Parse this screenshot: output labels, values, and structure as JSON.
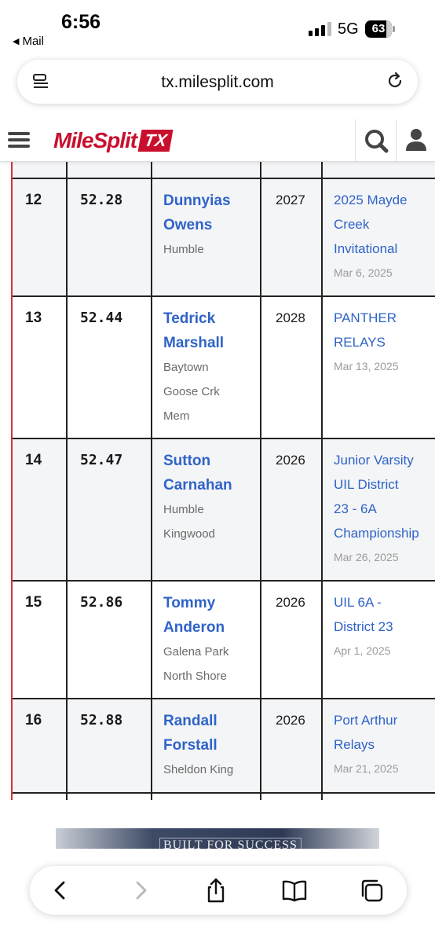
{
  "status_bar": {
    "time": "6:56",
    "back_app": "Mail",
    "network": "5G",
    "battery": "63"
  },
  "browser": {
    "url": "tx.milesplit.com"
  },
  "site": {
    "logo_text": "MileSplit",
    "logo_region": "TX",
    "brand_color": "#c8102e"
  },
  "rows": [
    {
      "rank": "12",
      "mark": "52.28",
      "athlete_line1": "Dunnyias",
      "athlete_line2": "Owens",
      "school_line1": "Humble",
      "school_line2": "",
      "school_line3": "",
      "grad": "2027",
      "meet_line1": "2025 Mayde",
      "meet_line2": "Creek",
      "meet_line3": "Invitational",
      "meet_line4": "",
      "date": "Mar 6, 2025"
    },
    {
      "rank": "13",
      "mark": "52.44",
      "athlete_line1": "Tedrick",
      "athlete_line2": "Marshall",
      "school_line1": "Baytown",
      "school_line2": "Goose Crk",
      "school_line3": "Mem",
      "grad": "2028",
      "meet_line1": "PANTHER",
      "meet_line2": "RELAYS",
      "meet_line3": "",
      "meet_line4": "",
      "date": "Mar 13, 2025"
    },
    {
      "rank": "14",
      "mark": "52.47",
      "athlete_line1": "Sutton",
      "athlete_line2": "Carnahan",
      "school_line1": "Humble",
      "school_line2": "Kingwood",
      "school_line3": "",
      "grad": "2026",
      "meet_line1": "Junior Varsity",
      "meet_line2": "UIL District",
      "meet_line3": "23 - 6A",
      "meet_line4": "Championship",
      "date": "Mar 26, 2025"
    },
    {
      "rank": "15",
      "mark": "52.86",
      "athlete_line1": "Tommy",
      "athlete_line2": "Anderon",
      "school_line1": "Galena Park",
      "school_line2": "North Shore",
      "school_line3": "",
      "grad": "2026",
      "meet_line1": "UIL 6A -",
      "meet_line2": "District 23",
      "meet_line3": "",
      "meet_line4": "",
      "date": "Apr 1, 2025"
    },
    {
      "rank": "16",
      "mark": "52.88",
      "athlete_line1": "Randall",
      "athlete_line2": "Forstall",
      "school_line1": "Sheldon King",
      "school_line2": "",
      "school_line3": "",
      "grad": "2026",
      "meet_line1": "Port Arthur",
      "meet_line2": "Relays",
      "meet_line3": "",
      "meet_line4": "",
      "date": "Mar 21, 2025"
    }
  ],
  "ad": {
    "text": "BUILT FOR SUCCESS"
  },
  "toolbar": {
    "icons": [
      "back-icon",
      "forward-icon",
      "share-icon",
      "bookmarks-icon",
      "tabs-icon"
    ]
  }
}
